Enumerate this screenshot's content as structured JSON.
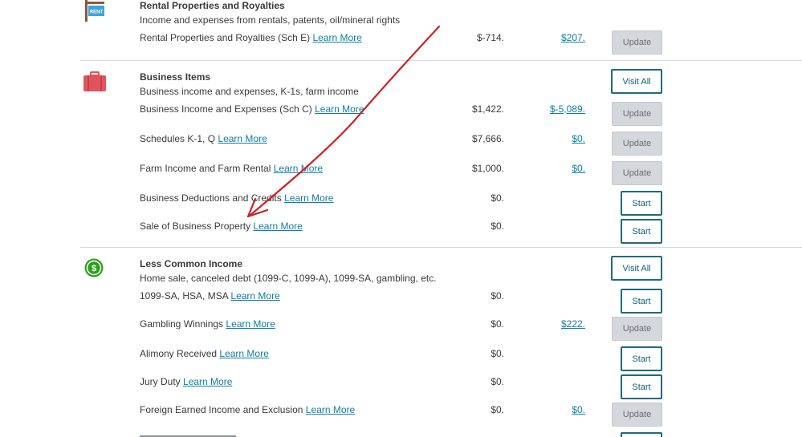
{
  "rental": {
    "title": "Rental Properties and Royalties",
    "subtitle": "Income and expenses from rentals, patents, oil/mineral rights",
    "sign_text": "RENT",
    "rows": [
      {
        "label": "Rental Properties and Royalties (Sch E)",
        "learn": "Learn More",
        "amount": "$-714.",
        "link_amount": "$207.",
        "button": "Update"
      }
    ]
  },
  "business": {
    "title": "Business Items",
    "subtitle": "Business income and expenses, K-1s, farm income",
    "visit_all": "Visit All",
    "rows": [
      {
        "label": "Business Income and Expenses (Sch C)",
        "learn": "Learn More",
        "amount": "$1,422.",
        "link_amount": "$-5,089.",
        "button": "Update"
      },
      {
        "label": "Schedules K-1, Q",
        "learn": "Learn More",
        "amount": "$7,666.",
        "link_amount": "$0.",
        "button": "Update"
      },
      {
        "label": "Farm Income and Farm Rental",
        "learn": "Learn More",
        "amount": "$1,000.",
        "link_amount": "$0.",
        "button": "Update"
      },
      {
        "label": "Business Deductions and Credits",
        "learn": "Learn More",
        "amount": "$0.",
        "link_amount": "",
        "button": "Start"
      },
      {
        "label": "Sale of Business Property",
        "learn": "Learn More",
        "amount": "$0.",
        "link_amount": "",
        "button": "Start"
      }
    ]
  },
  "less_common": {
    "title": "Less Common Income",
    "subtitle": "Home sale, canceled debt (1099-C, 1099-A), 1099-SA, gambling, etc.",
    "visit_all": "Visit All",
    "icon_text": "$",
    "rows": [
      {
        "label": "1099-SA, HSA, MSA",
        "learn": "Learn More",
        "amount": "$0.",
        "link_amount": "",
        "button": "Start"
      },
      {
        "label": "Gambling Winnings",
        "learn": "Learn More",
        "amount": "$0.",
        "link_amount": "$222.",
        "button": "Update"
      },
      {
        "label": "Alimony Received",
        "learn": "Learn More",
        "amount": "$0.",
        "link_amount": "",
        "button": "Start"
      },
      {
        "label": "Jury Duty",
        "learn": "Learn More",
        "amount": "$0.",
        "link_amount": "",
        "button": "Start"
      },
      {
        "label": "Foreign Earned Income and Exclusion",
        "learn": "Learn More",
        "amount": "$0.",
        "link_amount": "$0.",
        "button": "Update"
      }
    ]
  },
  "colors": {
    "link": "#0d7ea6",
    "briefcase": "#e2545c",
    "sign": "#40a4d8",
    "dollar_icon": "#2ca01c",
    "arrow": "#cc2027"
  }
}
